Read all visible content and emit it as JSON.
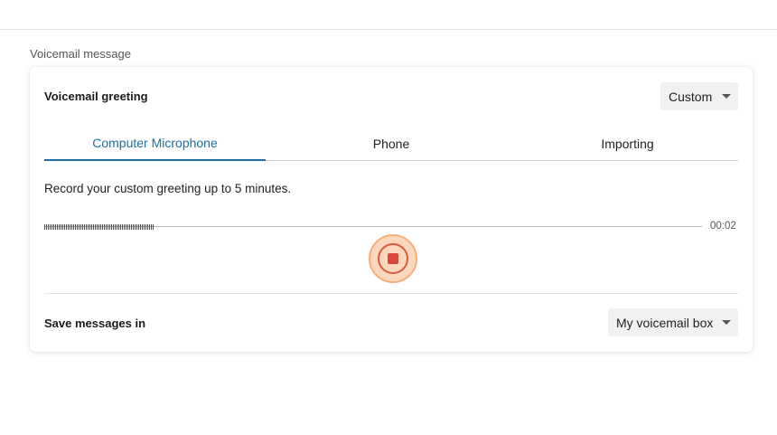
{
  "section_label": "Voicemail message",
  "greeting": {
    "title": "Voicemail greeting",
    "select_value": "Custom"
  },
  "tabs": [
    {
      "label": "Computer Microphone",
      "active": true
    },
    {
      "label": "Phone",
      "active": false
    },
    {
      "label": "Importing",
      "active": false
    }
  ],
  "recorder": {
    "instructions": "Record your custom greeting up to 5 minutes.",
    "elapsed": "00:02",
    "progress_fraction": 0.167
  },
  "save": {
    "title": "Save messages in",
    "select_value": "My voicemail box"
  },
  "colors": {
    "accent": "#1f6fa0",
    "record": "#d9493a",
    "record_halo": "#fcd7bb"
  }
}
